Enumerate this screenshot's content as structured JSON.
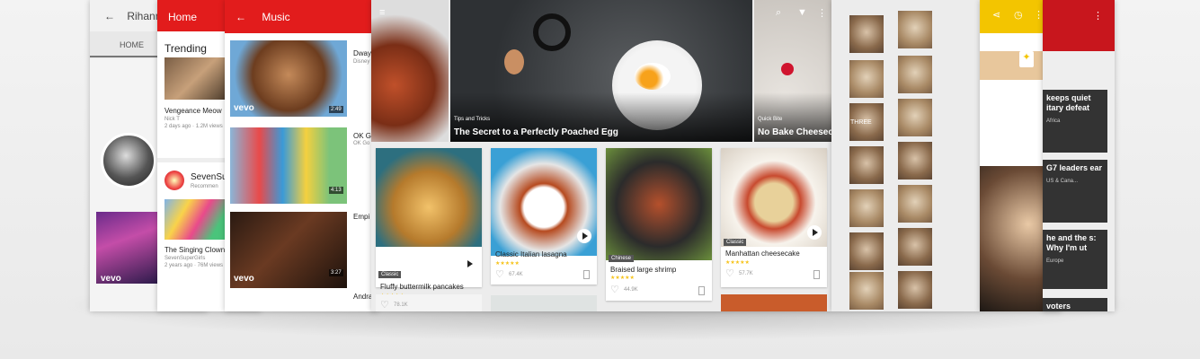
{
  "screens": {
    "rihanna": {
      "title": "RihannaV",
      "tab": "HOME",
      "brand": "vevo"
    },
    "home": {
      "title": "Home",
      "section": "Trending",
      "video1": {
        "title": "Vengeance Meow",
        "channel": "Nick T",
        "meta": "2 days ago · 1.2M views"
      },
      "channel": {
        "name": "SevenSu",
        "sub": "Recommen"
      },
      "video2": {
        "title": "The Singing Clown!",
        "channel": "SevenSuperGirls",
        "meta": "2 years ago · 76M views"
      }
    },
    "music": {
      "title": "Music",
      "items": [
        {
          "side_title": "Dway",
          "side_sub": "Disney",
          "duration": "2:49",
          "brand": "vevo"
        },
        {
          "side_title": "OK Go",
          "side_sub": "OK Go",
          "duration": "4:13"
        },
        {
          "side_title": "Empi",
          "side_sub": "",
          "duration": "3:27",
          "brand": "vevo"
        },
        {
          "side_title": "Andra"
        }
      ]
    },
    "recipes": {
      "hero": [
        {
          "kicker": "",
          "title": ""
        },
        {
          "kicker": "Tips and Tricks",
          "title": "The Secret to a Perfectly Poached Egg"
        },
        {
          "kicker": "Quick Bite",
          "title": "No Bake Cheesec"
        }
      ],
      "cards": [
        {
          "category": "Classic",
          "title": "Fluffy buttermilk pancakes",
          "stars": "★★★★★",
          "likes": "78.1K"
        },
        {
          "category": "",
          "title": "Classic Italian lasagna",
          "stars": "★★★★★",
          "likes": "67.4K"
        },
        {
          "category": "Chinese",
          "title": "Braised large shrimp",
          "stars": "★★★★★",
          "likes": "44.9K"
        },
        {
          "category": "Classic",
          "title": "Manhattan cheesecake",
          "stars": "★★★★★",
          "likes": "57.7K"
        }
      ]
    },
    "hairstyles": {
      "caption": "THREE"
    },
    "news": {
      "stories": [
        {
          "headline": "keeps quiet itary defeat",
          "meta": "Africa"
        },
        {
          "headline": "G7 leaders ear",
          "meta": "US & Cana..."
        },
        {
          "headline": "he and the s: Why I'm ut",
          "meta": "Europe"
        },
        {
          "headline": "voters"
        }
      ]
    }
  },
  "colors": {
    "red": "#e21c1c",
    "yellow": "#f3c500",
    "news_red": "#c8161d"
  }
}
